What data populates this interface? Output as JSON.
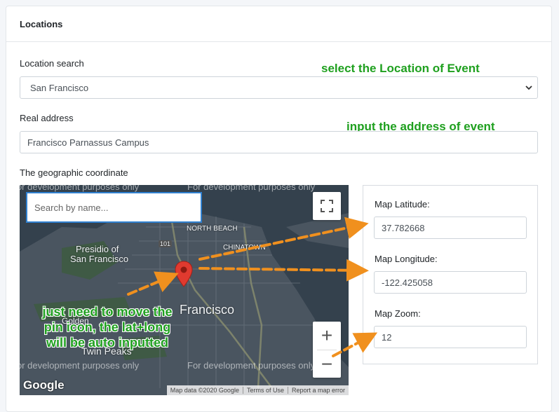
{
  "card": {
    "title": "Locations"
  },
  "location_search": {
    "label": "Location search",
    "selected": "San Francisco",
    "annotation": "select the Location of Event"
  },
  "real_address": {
    "label": "Real address",
    "value": "Francisco Parnassus Campus",
    "annotation": "input the address of event"
  },
  "geo": {
    "label": "The geographic coordinate",
    "map": {
      "search_placeholder": "Search by name...",
      "dev_watermark": "For development purposes only",
      "place_labels": [
        "NORTH BEACH",
        "Presidio of",
        "San Francisco",
        "CHINATOWN",
        "Francisco",
        "Twin Peaks",
        "101",
        "Golden"
      ],
      "zoom_in": "+",
      "zoom_out": "−",
      "logo": "Google",
      "attribution": [
        "Map data ©2020 Google",
        "Terms of Use",
        "Report a map error"
      ],
      "annotation_lines": [
        "just need to move the",
        "pin icon,  the lat+long",
        "will be auto inputted"
      ]
    },
    "latitude": {
      "label": "Map Latitude:",
      "value": "37.782668"
    },
    "longitude": {
      "label": "Map Longitude:",
      "value": "-122.425058"
    },
    "zoom": {
      "label": "Map Zoom:",
      "value": "12"
    }
  },
  "colors": {
    "annotation": "#1fa01f",
    "arrow": "#f0901e",
    "pin": "#e03a2f",
    "search_border": "#2f80d0"
  }
}
